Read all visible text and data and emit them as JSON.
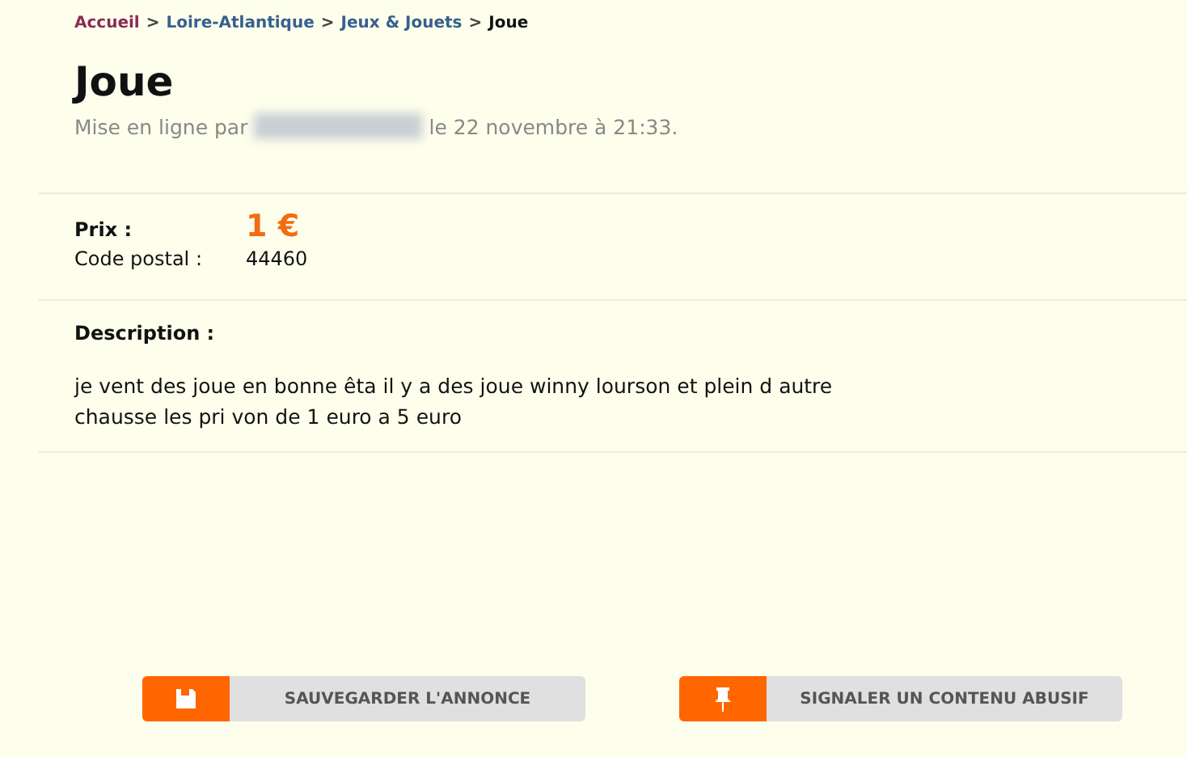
{
  "breadcrumb": [
    {
      "label": "Accueil",
      "kind": "home"
    },
    {
      "label": "Loire-Atlantique",
      "kind": "link"
    },
    {
      "label": "Jeux & Jouets",
      "kind": "link"
    },
    {
      "label": "Joue",
      "kind": "current"
    }
  ],
  "breadcrumb_separator": ">",
  "title": "Joue",
  "posted": {
    "prefix": "Mise en ligne par",
    "suffix": "le 22 novembre à 21:33."
  },
  "details": [
    {
      "label": "Prix :",
      "value": "1 €",
      "kind": "price"
    },
    {
      "label": "Code postal :",
      "value": "44460",
      "kind": "plain"
    }
  ],
  "description": {
    "label": "Description :",
    "text": "je vent des joue en bonne êta il y a des joue winny lourson et plein d autre chausse les pri von de 1 euro a 5 euro"
  },
  "buttons": [
    {
      "label": "SAUVEGARDER L'ANNONCE",
      "kind": "save"
    },
    {
      "label": "SIGNALER UN CONTENU ABUSIF",
      "kind": "report"
    }
  ]
}
